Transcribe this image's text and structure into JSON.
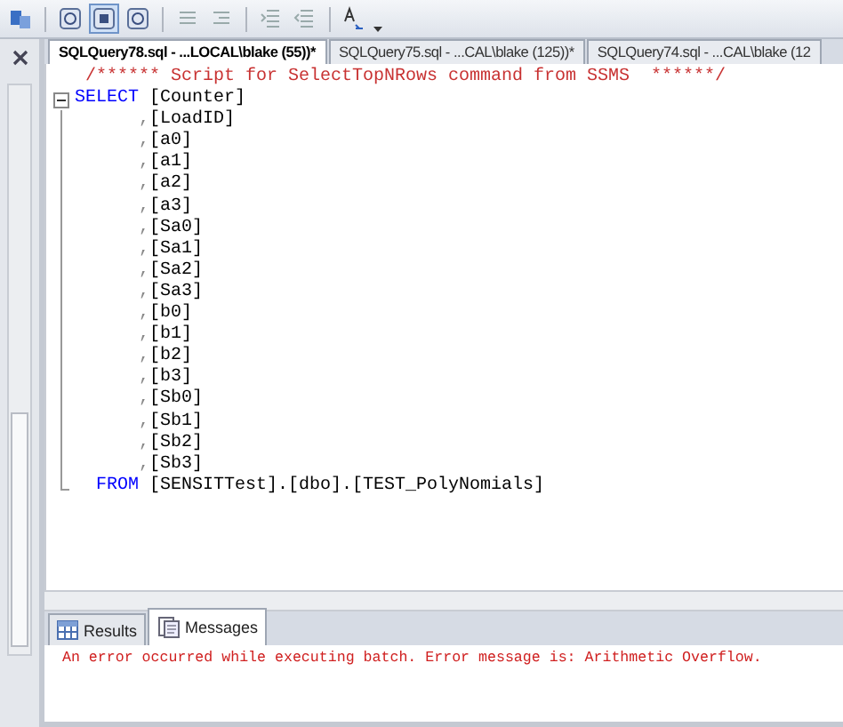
{
  "doc_tabs": [
    {
      "label": "SQLQuery78.sql - ...LOCAL\\blake (55))*",
      "selected": true
    },
    {
      "label": "SQLQuery75.sql - ...CAL\\blake (125))*",
      "selected": false
    },
    {
      "label": "SQLQuery74.sql - ...CAL\\blake (12",
      "selected": false
    }
  ],
  "code_lines": [
    {
      "kind": "comment",
      "segments": [
        {
          "kind": "comment",
          "text": "/****** Script for SelectTopNRows command from SSMS  ******/"
        }
      ]
    },
    {
      "kind": "select",
      "segments": [
        {
          "kind": "keyword",
          "text": "SELECT"
        },
        {
          "kind": "plain",
          "text": " [Counter]"
        }
      ]
    },
    {
      "kind": "column",
      "segments": [
        {
          "kind": "punct",
          "text": ","
        },
        {
          "kind": "plain",
          "text": "[LoadID]"
        }
      ]
    },
    {
      "kind": "column",
      "segments": [
        {
          "kind": "punct",
          "text": ","
        },
        {
          "kind": "plain",
          "text": "[a0]"
        }
      ]
    },
    {
      "kind": "column",
      "segments": [
        {
          "kind": "punct",
          "text": ","
        },
        {
          "kind": "plain",
          "text": "[a1]"
        }
      ]
    },
    {
      "kind": "column",
      "segments": [
        {
          "kind": "punct",
          "text": ","
        },
        {
          "kind": "plain",
          "text": "[a2]"
        }
      ]
    },
    {
      "kind": "column",
      "segments": [
        {
          "kind": "punct",
          "text": ","
        },
        {
          "kind": "plain",
          "text": "[a3]"
        }
      ]
    },
    {
      "kind": "column",
      "segments": [
        {
          "kind": "punct",
          "text": ","
        },
        {
          "kind": "plain",
          "text": "[Sa0]"
        }
      ]
    },
    {
      "kind": "column",
      "segments": [
        {
          "kind": "punct",
          "text": ","
        },
        {
          "kind": "plain",
          "text": "[Sa1]"
        }
      ]
    },
    {
      "kind": "column",
      "segments": [
        {
          "kind": "punct",
          "text": ","
        },
        {
          "kind": "plain",
          "text": "[Sa2]"
        }
      ]
    },
    {
      "kind": "column",
      "segments": [
        {
          "kind": "punct",
          "text": ","
        },
        {
          "kind": "plain",
          "text": "[Sa3]"
        }
      ]
    },
    {
      "kind": "column",
      "segments": [
        {
          "kind": "punct",
          "text": ","
        },
        {
          "kind": "plain",
          "text": "[b0]"
        }
      ]
    },
    {
      "kind": "column",
      "segments": [
        {
          "kind": "punct",
          "text": ","
        },
        {
          "kind": "plain",
          "text": "[b1]"
        }
      ]
    },
    {
      "kind": "column",
      "segments": [
        {
          "kind": "punct",
          "text": ","
        },
        {
          "kind": "plain",
          "text": "[b2]"
        }
      ]
    },
    {
      "kind": "column",
      "segments": [
        {
          "kind": "punct",
          "text": ","
        },
        {
          "kind": "plain",
          "text": "[b3]"
        }
      ]
    },
    {
      "kind": "column",
      "segments": [
        {
          "kind": "punct",
          "text": ","
        },
        {
          "kind": "plain",
          "text": "[Sb0]"
        }
      ]
    },
    {
      "kind": "column",
      "segments": [
        {
          "kind": "punct",
          "text": ","
        },
        {
          "kind": "plain",
          "text": "[Sb1]"
        }
      ]
    },
    {
      "kind": "column",
      "segments": [
        {
          "kind": "punct",
          "text": ","
        },
        {
          "kind": "plain",
          "text": "[Sb2]"
        }
      ]
    },
    {
      "kind": "column",
      "segments": [
        {
          "kind": "punct",
          "text": ","
        },
        {
          "kind": "plain",
          "text": "[Sb3]"
        }
      ]
    },
    {
      "kind": "from",
      "segments": [
        {
          "kind": "keyword",
          "text": "FROM"
        },
        {
          "kind": "plain",
          "text": " [SENSITTest].[dbo].[TEST_PolyNomials]"
        }
      ]
    }
  ],
  "result_tabs": [
    {
      "label": "Results",
      "kind": "grid",
      "selected": false
    },
    {
      "label": "Messages",
      "kind": "messages",
      "selected": true
    }
  ],
  "messages": [
    {
      "kind": "error",
      "text": "An error occurred while executing batch. Error message is: Arithmetic Overflow."
    }
  ]
}
